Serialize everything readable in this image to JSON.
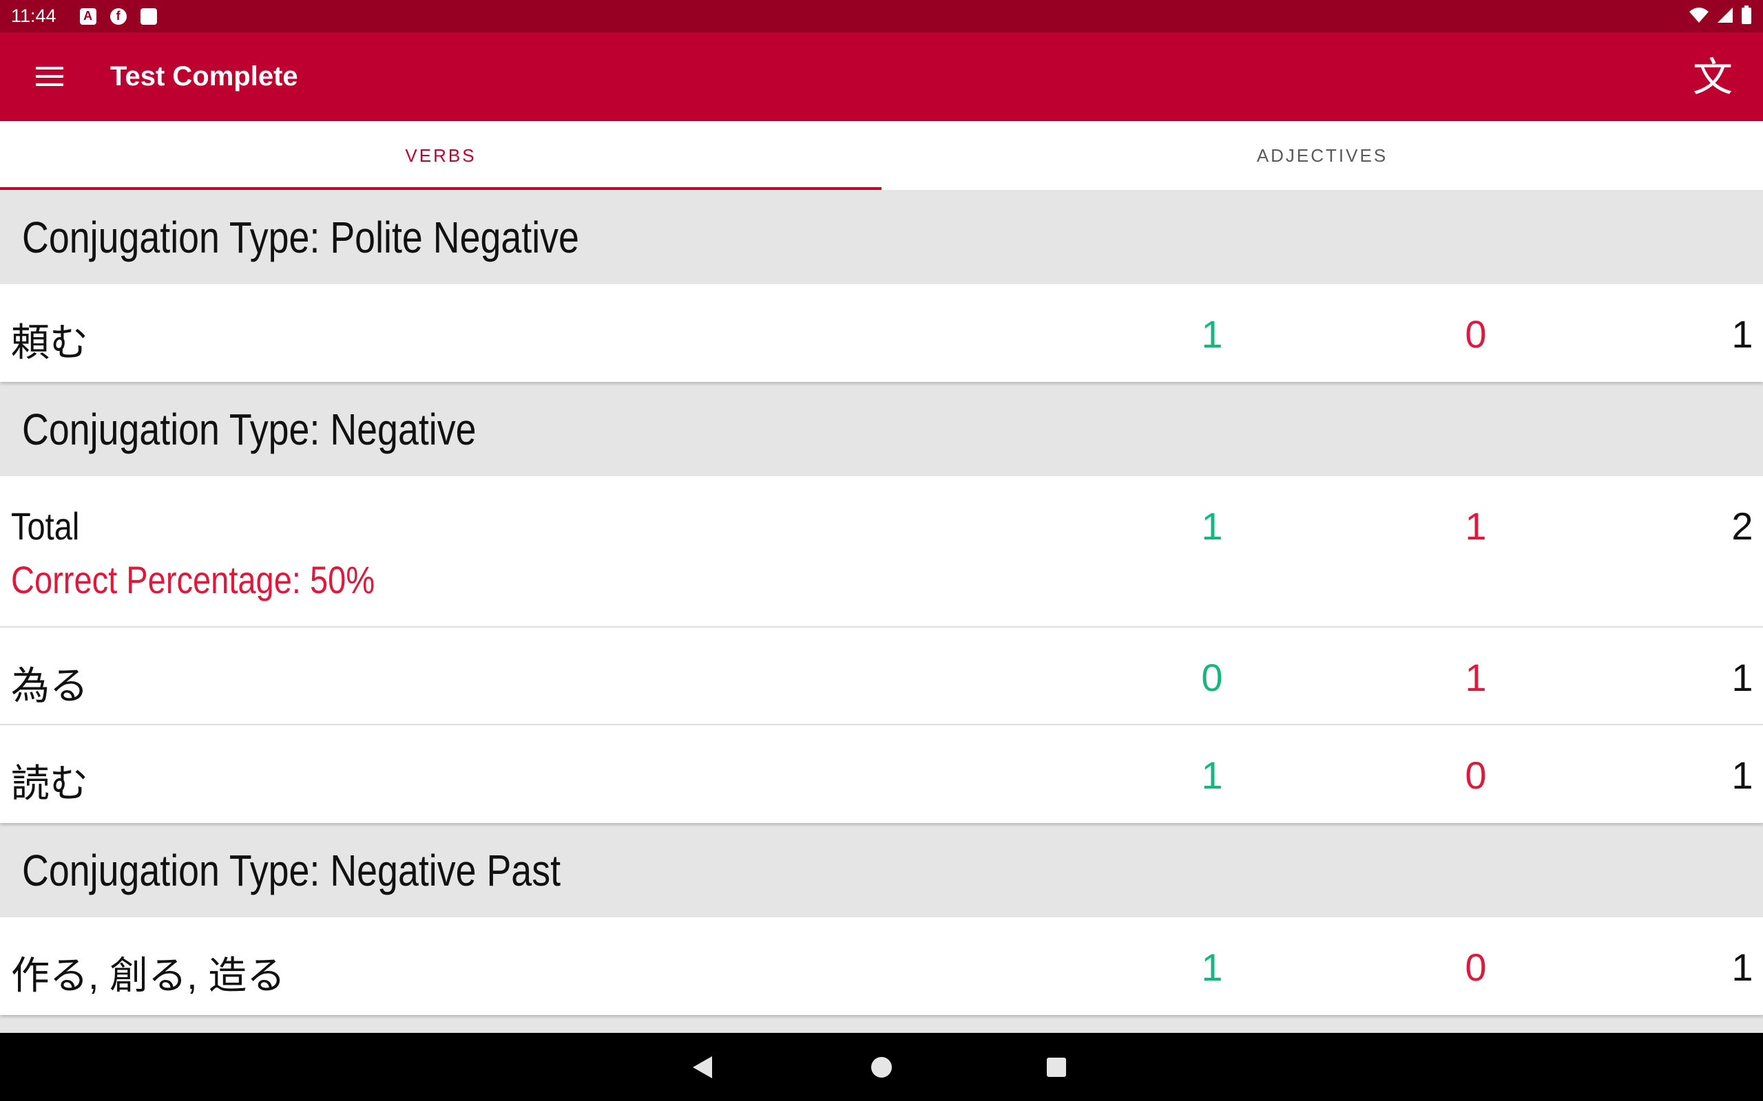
{
  "status_bar": {
    "time": "11:44",
    "left_icons": [
      "a-badge-icon",
      "flip-icon",
      "sd-card-icon"
    ],
    "right_icons": [
      "wifi-icon",
      "signal-icon",
      "battery-icon"
    ]
  },
  "app_bar": {
    "title": "Test Complete",
    "translate_glyph": "文"
  },
  "tabs": [
    {
      "label": "VERBS",
      "active": true
    },
    {
      "label": "ADJECTIVES",
      "active": false
    }
  ],
  "sections": [
    {
      "header": "Conjugation Type: Polite Negative",
      "rows": [
        {
          "label": "頼む",
          "correct": "1",
          "wrong": "0",
          "total": "1"
        }
      ]
    },
    {
      "header": "Conjugation Type: Negative",
      "rows": [
        {
          "label": "Total",
          "sub": "Correct Percentage: 50%",
          "correct": "1",
          "wrong": "1",
          "total": "2"
        },
        {
          "label": "為る",
          "correct": "0",
          "wrong": "1",
          "total": "1"
        },
        {
          "label": "読む",
          "correct": "1",
          "wrong": "0",
          "total": "1"
        }
      ]
    },
    {
      "header": "Conjugation Type: Negative Past",
      "rows": [
        {
          "label": "作る, 創る, 造る",
          "correct": "1",
          "wrong": "0",
          "total": "1"
        }
      ]
    }
  ],
  "colors": {
    "status_bar": "#970022",
    "app_bar": "#bd002f",
    "correct": "#17b67e",
    "wrong": "#e0183c"
  }
}
